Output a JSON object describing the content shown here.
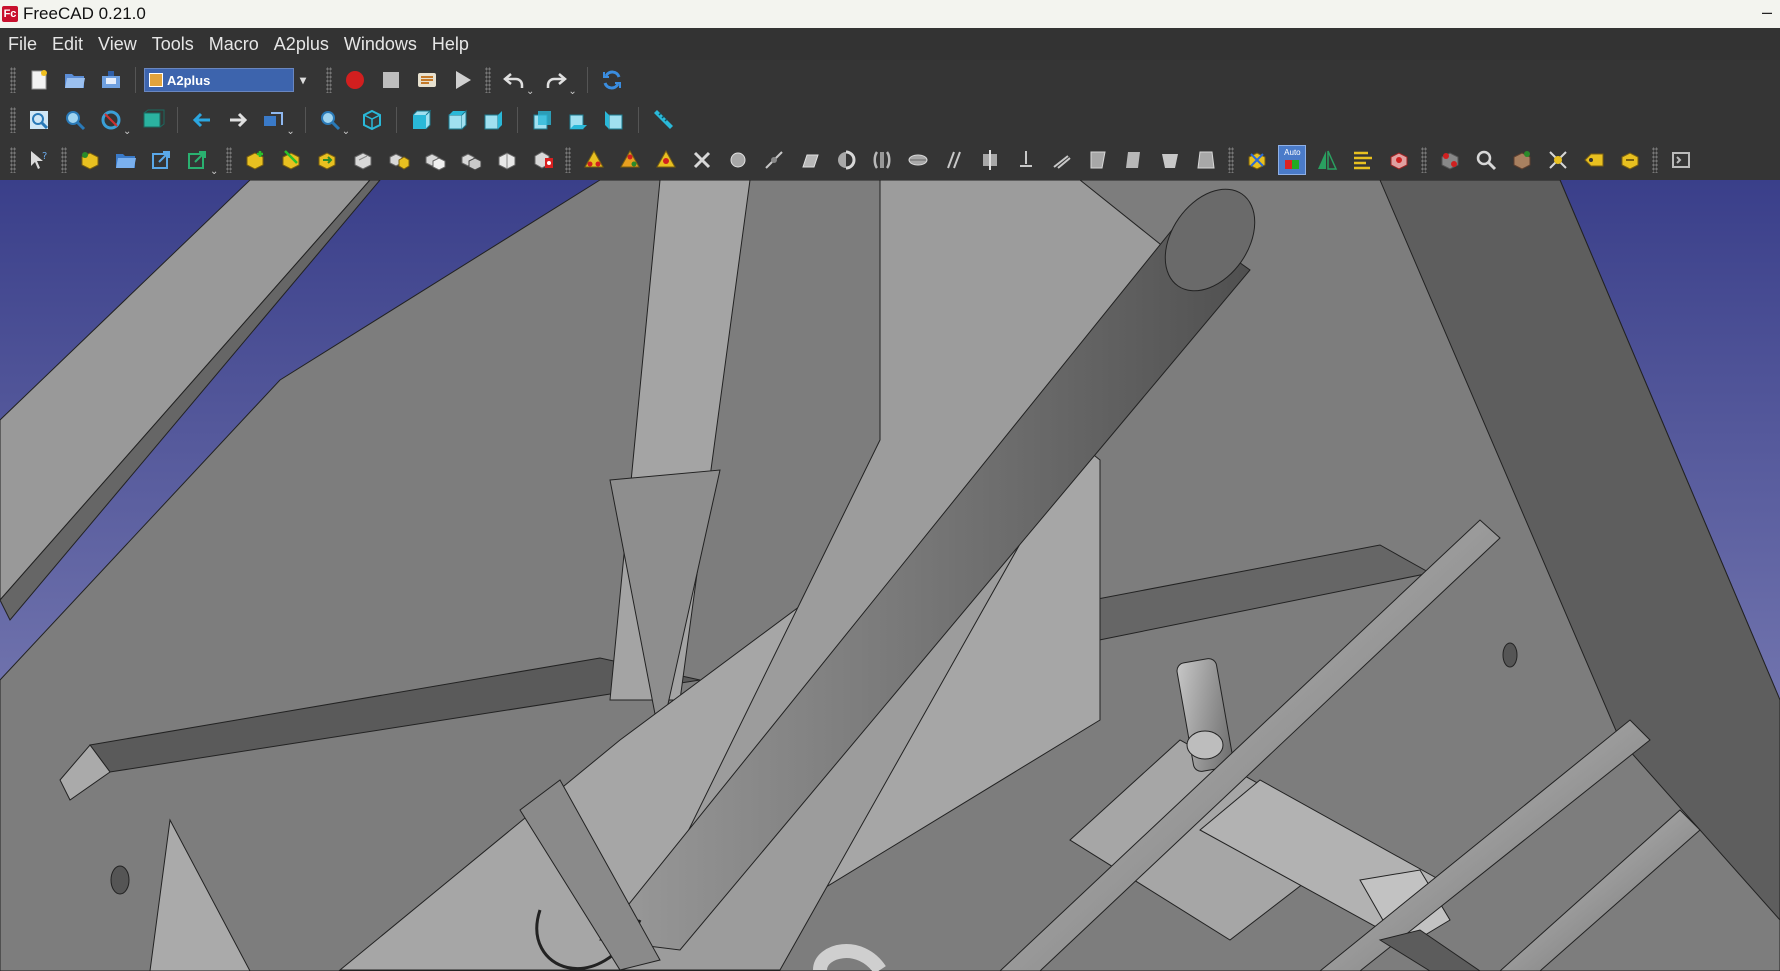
{
  "window": {
    "title": "FreeCAD 0.21.0",
    "logo_text": "Fc",
    "minimize_glyph": "–"
  },
  "menubar": {
    "items": [
      "File",
      "Edit",
      "View",
      "Tools",
      "Macro",
      "A2plus",
      "Windows",
      "Help"
    ]
  },
  "toolbar": {
    "workbench_selected": "A2plus",
    "auto_button_label": "Auto",
    "dropdown_glyph": "⌄"
  },
  "colors": {
    "viewport_top": "#3a3f8a",
    "viewport_bottom": "#8d8fc0",
    "model_grey": "#8c8c8c",
    "accent_blue": "#3d64ad",
    "record_red": "#d21f1f"
  },
  "icons": {
    "row1": [
      "new-document-icon",
      "open-folder-icon",
      "save-icon",
      "workbench-selector",
      "record-macro-icon",
      "stop-macro-icon",
      "macro-editor-icon",
      "run-macro-icon",
      "undo-icon",
      "redo-icon",
      "refresh-icon"
    ],
    "row2": [
      "fit-all-icon",
      "fit-selection-icon",
      "draw-style-icon",
      "bounding-box-icon",
      "back-icon",
      "forward-icon",
      "sync-view-icon",
      "zoom-icon",
      "isometric-view-icon",
      "front-view-icon",
      "top-view-icon",
      "right-view-icon",
      "rear-view-icon",
      "bottom-view-icon",
      "left-view-icon",
      "measure-icon"
    ],
    "row3": [
      "whats-this-icon",
      "add-part-icon",
      "open-assembly-icon",
      "import-part-icon",
      "update-imported-icon",
      "add-constraint-icon",
      "solve-icon",
      "convert-part-icon",
      "duplicate-part-icon",
      "toggle-transparency-icon",
      "point-identity-icon",
      "point-on-line-icon",
      "point-on-plane-icon",
      "delete-icon",
      "sphere-center-icon",
      "circular-edge-icon",
      "plane-coincident-icon",
      "axial-icon",
      "axis-coincident-icon",
      "angled-planes-icon",
      "plane-parallel-icon",
      "axis-parallel-icon",
      "axis-plane-parallel-icon",
      "axis-plane-normal-icon",
      "axis-plane-angle-icon",
      "center-of-mass-icon",
      "lock-icon",
      "auto-solve-button",
      "flip-constraint-icon",
      "show-constraints-icon",
      "constraint-viewer-icon",
      "explode-icon",
      "search-icon",
      "partlist-icon",
      "isolate-icon",
      "label-icon",
      "cycle-icon",
      "toolbar-extension-icon"
    ]
  }
}
